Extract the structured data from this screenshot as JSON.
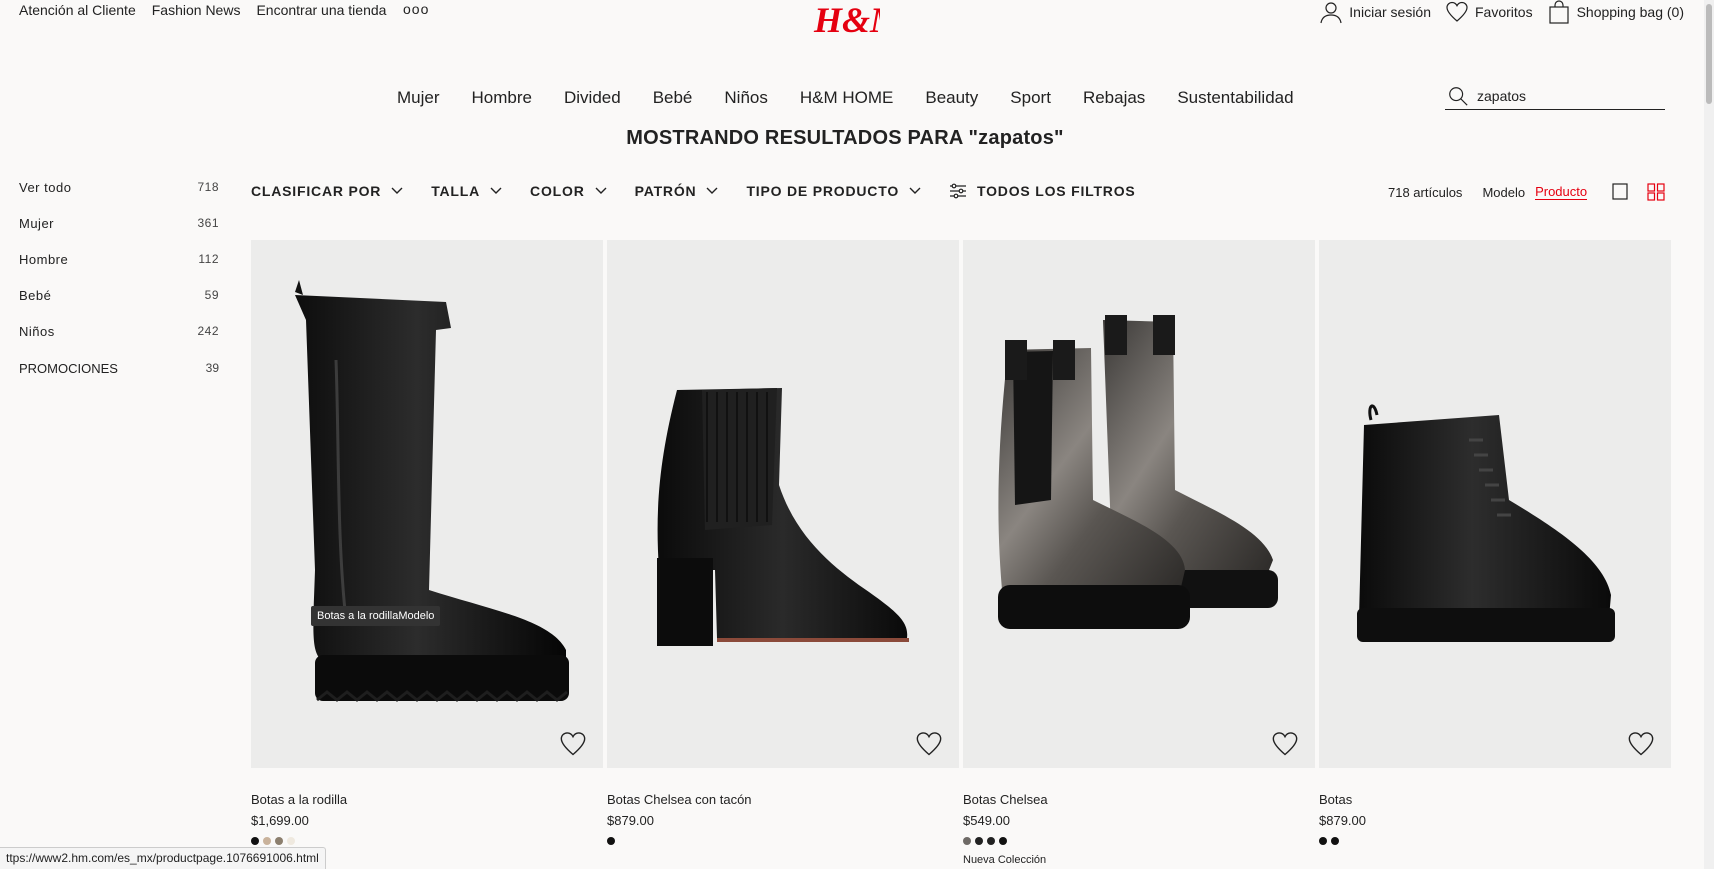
{
  "top_links": [
    "Atención al Cliente",
    "Fashion News",
    "Encontrar una tienda"
  ],
  "more_label": "ooo",
  "logo_text": "H&M",
  "account": {
    "signin": "Iniciar sesión",
    "favorites": "Favoritos",
    "bag": "Shopping bag (0)"
  },
  "nav": [
    "Mujer",
    "Hombre",
    "Divided",
    "Bebé",
    "Niños",
    "H&M HOME",
    "Beauty",
    "Sport",
    "Rebajas",
    "Sustentabilidad"
  ],
  "search": {
    "value": "zapatos"
  },
  "results_title": "MOSTRANDO RESULTADOS PARA \"zapatos\"",
  "sidebar": [
    {
      "label": "Ver todo",
      "count": "718"
    },
    {
      "label": "Mujer",
      "count": "361"
    },
    {
      "label": "Hombre",
      "count": "112"
    },
    {
      "label": "Bebé",
      "count": "59"
    },
    {
      "label": "Niños",
      "count": "242"
    },
    {
      "label": "PROMOCIONES",
      "count": "39"
    }
  ],
  "filters": [
    "CLASIFICAR POR",
    "TALLA",
    "COLOR",
    "PATRÓN",
    "TIPO DE PRODUCTO"
  ],
  "all_filters": "TODOS LOS FILTROS",
  "view": {
    "count": "718 artículos",
    "model": "Modelo",
    "product": "Producto"
  },
  "products": [
    {
      "name": "Botas a la rodilla",
      "price": "$1,699.00",
      "swatches": [
        "#111111",
        "#c9b29b",
        "#8c7f6e",
        "#efe9df"
      ],
      "tag": ""
    },
    {
      "name": "Botas Chelsea con tacón",
      "price": "$879.00",
      "swatches": [
        "#111111"
      ],
      "tag": ""
    },
    {
      "name": "Botas Chelsea",
      "price": "$549.00",
      "swatches": [
        "#6e6a66",
        "#222222",
        "#222222",
        "#111111"
      ],
      "tag": "Nueva Colección"
    },
    {
      "name": "Botas",
      "price": "$879.00",
      "swatches": [
        "#111111",
        "#111111"
      ],
      "tag": ""
    }
  ],
  "tooltip": "Botas a la rodillaModelo",
  "status_url": "ttps://www2.hm.com/es_mx/productpage.1076691006.html",
  "colors": {
    "accent": "#e50010",
    "logo": "#e50010"
  }
}
